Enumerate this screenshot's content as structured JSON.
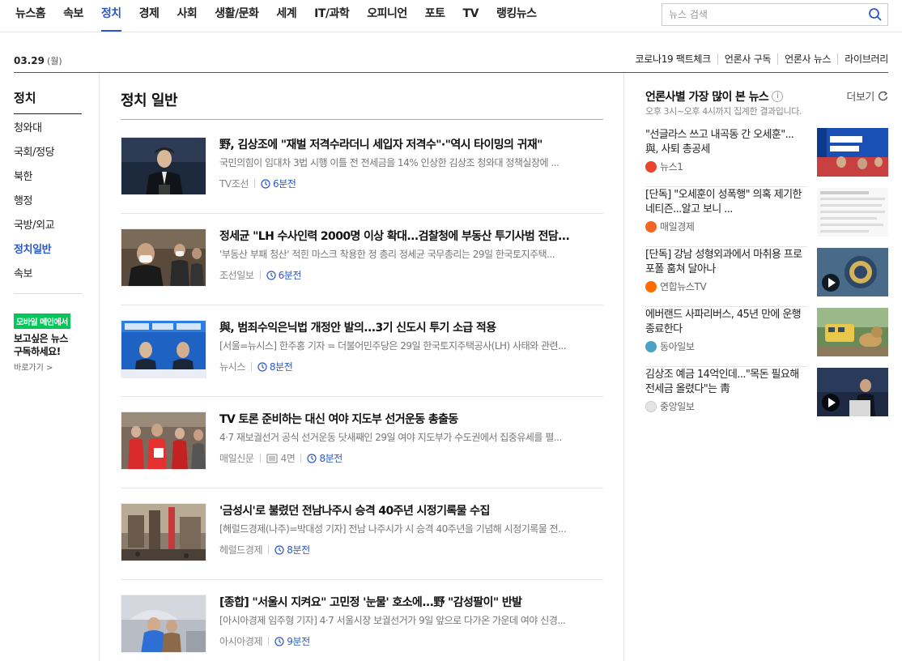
{
  "nav": {
    "items": [
      "뉴스홈",
      "속보",
      "정치",
      "경제",
      "사회",
      "생활/문화",
      "세계",
      "IT/과학",
      "오피니언",
      "포토",
      "TV",
      "랭킹뉴스"
    ],
    "active_index": 2,
    "search_placeholder": "뉴스 검색"
  },
  "subheader": {
    "date": "03.29",
    "day_of_week": "(월)",
    "links": [
      "코로나19 팩트체크",
      "언론사 구독",
      "언론사 뉴스",
      "라이브러리"
    ]
  },
  "sidebar": {
    "title": "정치",
    "items": [
      "청와대",
      "국회/정당",
      "북한",
      "행정",
      "국방/외교",
      "정치일반",
      "속보"
    ],
    "active_index": 5,
    "promo_badge": "모바일 메인에서",
    "promo_line1": "보고싶은 뉴스",
    "promo_line2": "구독하세요!",
    "promo_link": "바로가기 >"
  },
  "main": {
    "title": "정치 일반",
    "articles": [
      {
        "title": "野, 김상조에 \"재벌 저격수라더니 세입자 저격수\"·\"역시 타이밍의 귀재\"",
        "desc": "국민의힘이 임대차 3법 시행 이틀 전 전세금을 14% 인상한 김상조 청와대 정책실장에 ...",
        "press": "TV조선",
        "page": "",
        "time": "6분전"
      },
      {
        "title": "정세균 \"LH 수사인력 2000명 이상 확대...검찰청에 부동산 투기사범 전담...",
        "desc": "'부동산 부패 청산' 적힌 마스크 착용한 정 총리 정세균 국무총리는 29일 한국토지주택...",
        "press": "조선일보",
        "page": "",
        "time": "6분전"
      },
      {
        "title": "與, 범죄수익은닉법 개정안 발의...3기 신도시 투기 소급 적용",
        "desc": "[서울=뉴시스] 한주홍 기자 = 더불어민주당은 29일 한국토지주택공사(LH) 사태와 관련...",
        "press": "뉴시스",
        "page": "",
        "time": "8분전"
      },
      {
        "title": "TV 토론 준비하는 대신 여야 지도부 선거운동 총출동",
        "desc": "4·7 재보궐선거 공식 선거운동 닷새째인 29일 여야 지도부가 수도권에서 집중유세를 펼...",
        "press": "매일신문",
        "page": "4면",
        "time": "8분전"
      },
      {
        "title": "'금성시'로 불렸던 전남나주시 승격 40주년 시정기록물 수집",
        "desc": "[헤럴드경제(나주)=박대성 기자] 전남 나주시가 시 승격 40주년을 기념해 시정기록물 전...",
        "press": "헤럴드경제",
        "page": "",
        "time": "8분전"
      },
      {
        "title": "[종합] \"서울시 지켜요\" 고민정 '눈물' 호소에...野 \"감성팔이\" 반발",
        "desc": "[아시아경제 임주형 기자] 4·7 서울시장 보궐선거가 9일 앞으로 다가온 가운데 여야 신경...",
        "press": "아시아경제",
        "page": "",
        "time": "9분전"
      }
    ]
  },
  "right": {
    "title": "언론사별 가장 많이 본 뉴스",
    "more_label": "더보기",
    "subtitle": "오후 3시~오후 4시까지 집계한 결과입니다.",
    "items": [
      {
        "headline": "\"선글라스 쓰고 내곡동 간 오세훈\"... 與, 사퇴 총공세",
        "press": "뉴스1",
        "logo_color": "#e8452c",
        "video": false
      },
      {
        "headline": "[단독] \"오세훈이 성폭행\" 의혹 제기한 네티즌...알고 보니 ...",
        "press": "매일경제",
        "logo_color": "#f26522",
        "video": false
      },
      {
        "headline": "[단독] 강남 성형외과에서 마취용 프로포폴 훔쳐 달아나",
        "press": "연합뉴스TV",
        "logo_color": "#ff6b00",
        "video": true
      },
      {
        "headline": "에버랜드 사파리버스, 45년 만에 운행 종료한다",
        "press": "동아일보",
        "logo_color": "#4aa3c7",
        "video": false
      },
      {
        "headline": "김상조 예금 14억인데...\"목돈 필요해 전세금 올렸다\"는 靑",
        "press": "중앙일보",
        "logo_color": "#dddddd",
        "video": true
      }
    ]
  },
  "colors": {
    "accent": "#2b58c9",
    "promo_green": "#03c75a"
  }
}
